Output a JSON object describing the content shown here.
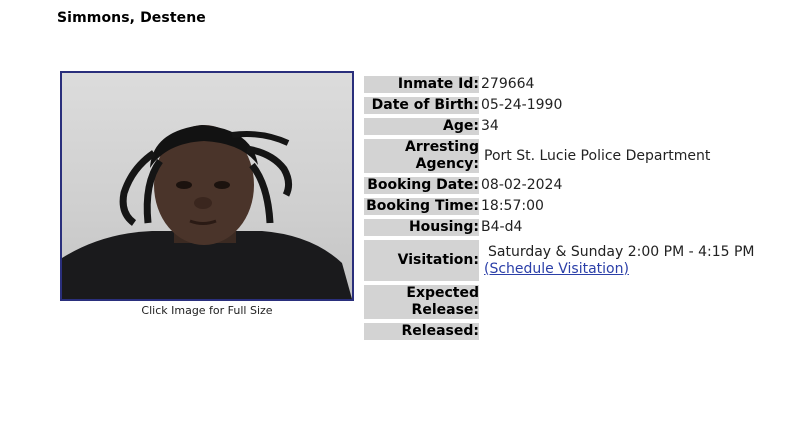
{
  "inmate_name": "Simmons, Destene",
  "photo": {
    "caption": "Click Image for Full Size"
  },
  "fields": {
    "inmate_id": {
      "label": "Inmate Id:",
      "value": "279664"
    },
    "date_of_birth": {
      "label": "Date of Birth:",
      "value": "05-24-1990"
    },
    "age": {
      "label": "Age:",
      "value": "34"
    },
    "arresting_agency": {
      "label_line1": "Arresting",
      "label_line2": "Agency:",
      "value": "Port St. Lucie Police Department"
    },
    "booking_date": {
      "label": "Booking Date:",
      "value": "08-02-2024"
    },
    "booking_time": {
      "label": "Booking Time:",
      "value": "18:57:00"
    },
    "housing": {
      "label": "Housing:",
      "value": "B4-d4"
    },
    "visitation": {
      "label": "Visitation:",
      "value": "Saturday & Sunday 2:00 PM - 4:15 PM",
      "link": "(Schedule Visitation)"
    },
    "expected_release": {
      "label_line1": "Expected",
      "label_line2": "Release:",
      "value": ""
    },
    "released": {
      "label": "Released:",
      "value": ""
    }
  }
}
